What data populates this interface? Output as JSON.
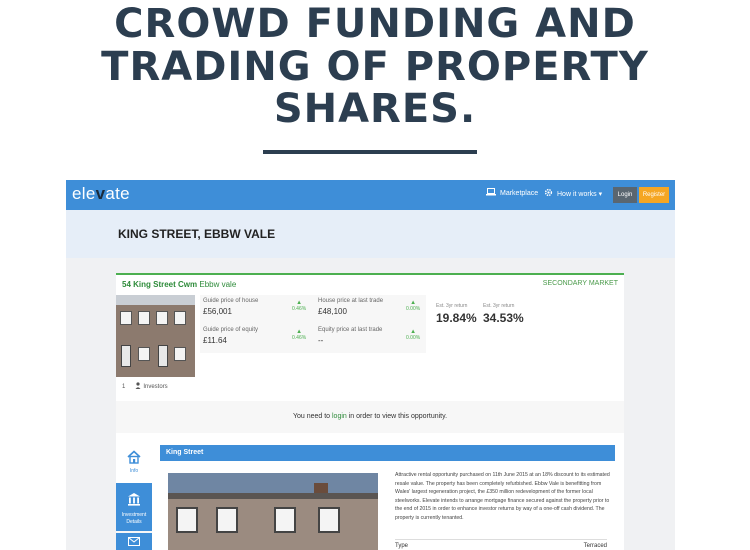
{
  "headline": {
    "line1": "CROWD FUNDING AND",
    "line2": "TRADING OF PROPERTY",
    "line3": "SHARES."
  },
  "app": {
    "logo": {
      "part1": "ele",
      "part2": "v",
      "part3": "ate"
    },
    "nav": {
      "marketplace": "Marketplace",
      "how_it_works": "How it works ▾"
    },
    "login_label": "Login",
    "register_label": "Register",
    "page_title": "KING STREET, EBBW VALE"
  },
  "property": {
    "title_bold": "54 King Street Cwm",
    "title_area": "Ebbw vale",
    "market_label": "SECONDARY MARKET",
    "guide_price_house_label": "Guide price of house",
    "guide_price_house": "£56,001",
    "guide_price_house_change": "0.46%",
    "house_price_last_trade_label": "House price at last trade",
    "house_price_last_trade": "£48,100",
    "house_price_last_trade_change": "0.00%",
    "guide_price_equity_label": "Guide price of equity",
    "guide_price_equity": "£11.64",
    "guide_price_equity_change": "0.46%",
    "equity_price_last_trade_label": "Equity price at last trade",
    "equity_price_last_trade": "--",
    "equity_price_last_trade_change": "0.00%",
    "est_return_1_label": "Est. 3yr return",
    "est_return_1": "19.84%",
    "est_return_2_label": "Est. 3yr return",
    "est_return_2": "34.53%",
    "investors_count": "1",
    "investors_label": "Investors"
  },
  "login_notice": {
    "before": "You need to ",
    "link": "login",
    "after": " in order to view this opportunity."
  },
  "sidebar": {
    "info_label": "Info",
    "investment_label": "Investment Details"
  },
  "section": {
    "header": "King Street",
    "description": "Attractive rental opportunity purchased on 11th June 2015 at an 18% discount to its estimated resale value. The property has been completely refurbished. Ebbw Vale is benefitting from Wales' largest regeneration project, the £350 million redevelopment of the former local steelworks. Elevate intends to arrange mortgage finance secured against the property prior to the end of 2015 in order to enhance investor returns by way of a one-off cash dividend. The property is currently tenanted.",
    "type_label": "Type",
    "type_value": "Terraced"
  },
  "colors": {
    "headline": "#2c3e50",
    "brand_blue": "#3e8ed8",
    "register_orange": "#f5a623",
    "positive_green": "#4caf50"
  },
  "icons": [
    "laptop-icon",
    "gear-icon",
    "arrow-up-icon",
    "person-icon",
    "home-icon",
    "bank-icon",
    "mail-icon"
  ]
}
